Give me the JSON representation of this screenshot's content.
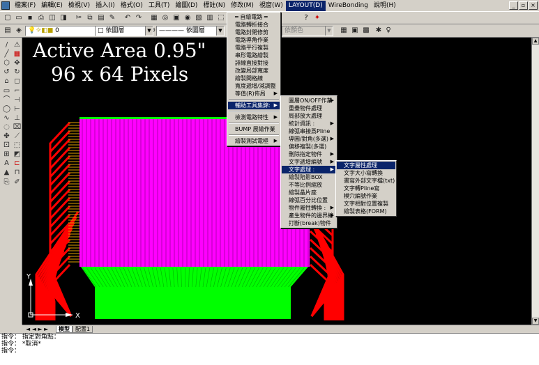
{
  "menubar": {
    "items": [
      "檔案(F)",
      "編輯(E)",
      "檢視(V)",
      "插入(I)",
      "格式(O)",
      "工具(T)",
      "繪圖(D)",
      "標註(N)",
      "修改(M)",
      "視窗(W)",
      "LAYOUT(D)",
      "WireBonding",
      "說明(H)"
    ],
    "active_index": 10
  },
  "toolbar2": {
    "layer_value": "0",
    "linetype1": "依圖層",
    "linetype2": "依圖層",
    "color_value": "依顏色"
  },
  "canvas": {
    "line1": "Active Area 0.95\"",
    "line2": "96 x 64 Pixels",
    "colors": {
      "background": "#000000",
      "magenta": "#ff00ff",
      "green": "#00ff00",
      "red": "#ff0000"
    },
    "axis": {
      "x": "X",
      "y": "Y"
    }
  },
  "layout_menu": {
    "items": [
      {
        "label": "═ 自繪電路 ═",
        "arrow": false
      },
      {
        "label": "電路轉折接合",
        "arrow": false
      },
      {
        "label": "電路封閉修剪",
        "arrow": false
      },
      {
        "label": "電路導角作業",
        "arrow": false
      },
      {
        "label": "電路平行複製",
        "arrow": false
      },
      {
        "label": "串形電路繪製",
        "arrow": false
      },
      {
        "label": "誹線直接對接",
        "arrow": false
      },
      {
        "label": "改變局部寬度",
        "arrow": false
      },
      {
        "label": "繪製間格線",
        "arrow": false
      },
      {
        "label": "寬度遞增/減調整",
        "arrow": false
      },
      {
        "label": "等值(R)佈局",
        "arrow": true
      },
      {
        "sep": true
      },
      {
        "label": "輔助工具集錦:",
        "arrow": true,
        "highlight": true
      },
      {
        "sep": true
      },
      {
        "label": "檢測電路特性",
        "arrow": true
      },
      {
        "sep": true
      },
      {
        "label": "BUMP 展繪作業",
        "arrow": false
      },
      {
        "sep": true
      },
      {
        "label": "繪製測試電極",
        "arrow": true
      }
    ]
  },
  "aux_menu": {
    "items": [
      {
        "label": "圖層ON/OFF作業",
        "arrow": true
      },
      {
        "label": "重疊物件處理",
        "arrow": false
      },
      {
        "label": "局部放大處理",
        "arrow": false
      },
      {
        "label": "統計資訊 :",
        "arrow": true
      },
      {
        "label": "線弧串接爲Pline",
        "arrow": false
      },
      {
        "label": "導圓/對角(多選)",
        "arrow": true
      },
      {
        "label": "偏移複製(多選)",
        "arrow": false
      },
      {
        "label": "刪除指定物件",
        "arrow": true
      },
      {
        "label": "文字遞增編號",
        "arrow": true
      },
      {
        "label": "文字處理 :",
        "arrow": true,
        "highlight": true
      },
      {
        "label": "繪製陷影BOX",
        "arrow": false
      },
      {
        "label": "不等比例縮放",
        "arrow": false
      },
      {
        "label": "繪製晶片座",
        "arrow": false
      },
      {
        "label": "線弧百分比位置",
        "arrow": false
      },
      {
        "label": "物件屬性轉換 :",
        "arrow": true
      },
      {
        "label": "產生物件的邊界線",
        "arrow": true
      },
      {
        "label": "打斷(break)物件",
        "arrow": false
      }
    ]
  },
  "text_menu": {
    "items": [
      {
        "label": "文字屬性處理",
        "highlight": true
      },
      {
        "label": "文字大小寫轉換"
      },
      {
        "label": "書寫外部文字檔(txt)"
      },
      {
        "label": "文字轉Pline寫"
      },
      {
        "label": "模穴編號作業"
      },
      {
        "label": "文字相對位置複製"
      },
      {
        "label": "繪製表格(FORM)"
      }
    ]
  },
  "tabs": {
    "nav": "◄ ◄ ► ►",
    "model": "模型",
    "layout1": "配置1"
  },
  "command": {
    "lines": [
      "指令： 指定對角點：",
      "指令： *取消*",
      "指令："
    ]
  }
}
